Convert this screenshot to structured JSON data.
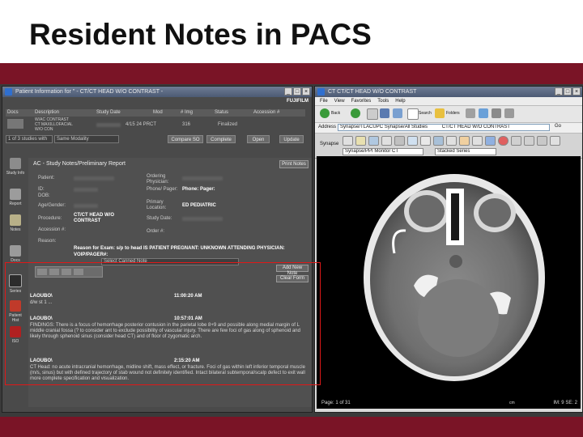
{
  "slide": {
    "title": "Resident Notes in PACS"
  },
  "left_window": {
    "title": "Patient Information for '' - CT/CT HEAD W/O CONTRAST -",
    "brand": "FUJIFILM",
    "grid_headers": [
      "Docs",
      "Description",
      "Study Date",
      "Mod",
      "# Img",
      "Status",
      "Accession #"
    ],
    "rows": [
      {
        "description": "W/AC CONTRAST\nCT MAXILLOFACIAL\nW/O CON",
        "date": "4/15 24 PRCT",
        "img": "316",
        "status": "Finalized"
      }
    ],
    "toolbar": {
      "count": "1 of 3 studies with",
      "modality": "Same Modality",
      "compare": "Compare SO",
      "complete": "Complete",
      "open": "Open",
      "update": "Update"
    },
    "sidebar": [
      "Study Info",
      "Report",
      "Notes",
      "Docs",
      "Series",
      "Patient Hist",
      "ISO"
    ],
    "notes": {
      "title": "AC - Study Notes/Preliminary Report",
      "print_button": "Print Notes",
      "labels": {
        "patient": "Patient:",
        "id": "ID:",
        "dob": "DOB:",
        "age_gender": "Age/Gender:",
        "procedure": "Procedure:",
        "accession": "Accession #:",
        "reason": "Reason:",
        "ordering": "Ordering Physician:",
        "phone": "Phone/ Pager:",
        "primary": "Primary Location:",
        "study_date": "Study Date:",
        "order": "Order #:"
      },
      "values": {
        "procedure": "CT/CT HEAD W/O CONTRAST",
        "phone": "Phone: Pager:",
        "primary": "ED PEDIATRIC"
      },
      "reason_text": "Reason for Exam: s/p to head IS PATIENT PREGNANT: UNKNOWN ATTENDING PHYSICIAN: VOIP/PAGER#:",
      "select_placeholder": "Select Canned Note",
      "add_note": "Add New Note",
      "clear_form": "Clear Form",
      "entries": [
        {
          "who": "LAOUBO\\",
          "when": "11:00:20 AM",
          "text": "d/w st 1 ..."
        },
        {
          "who": "LAOUBO\\",
          "when": "10:57:01 AM",
          "text": "FINDINGS: There is a focus of hemorrhage posterior contusion in the parietal lobe 8+9 and possible along medial margin of L middle cranial fossa (? to consider ant to exclude possibility of vascular injury. There are few foci of gas along of sphenoid and likely through sphenoid sinus (consider head CT) and of floor of zygomatic arch."
        },
        {
          "who": "LAOUBO\\",
          "when": "2:15:20 AM",
          "text": "CT Head: no acute intracranial hemorrhage, midline shift, mass effect, or fracture. Foci of gas within left inferior temporal muscle (m/s, sinus) but with defined trajectory of stab wound not definitely identified. Intact bilateral subtemporal/scalp defect to exit wall more complete specification and visualization."
        }
      ]
    }
  },
  "right_window": {
    "title": "CT CT/CT HEAD W/O CONTRAST",
    "menu": [
      "File",
      "View",
      "Favorites",
      "Tools",
      "Help"
    ],
    "toolbar": {
      "back": "Back",
      "search": "Search",
      "folders": "Folders"
    },
    "address_label": "Address",
    "address_value": "Synapse/TLACUPC Synapse/All Studies",
    "address_study": "CT/CT HEAD W/O CONTRAST",
    "go": "Go",
    "synapse_label": "Synapse",
    "viewer_dropdown": "Synapse/PPI Monitor CT",
    "layout_dropdown": "Stacked Series",
    "page": "Page: 1 of 31",
    "scale": "cm",
    "image_index": "IM: 9 SE: 2"
  },
  "colors": {
    "accent": "#7a1426",
    "highlight": "#e01818"
  }
}
